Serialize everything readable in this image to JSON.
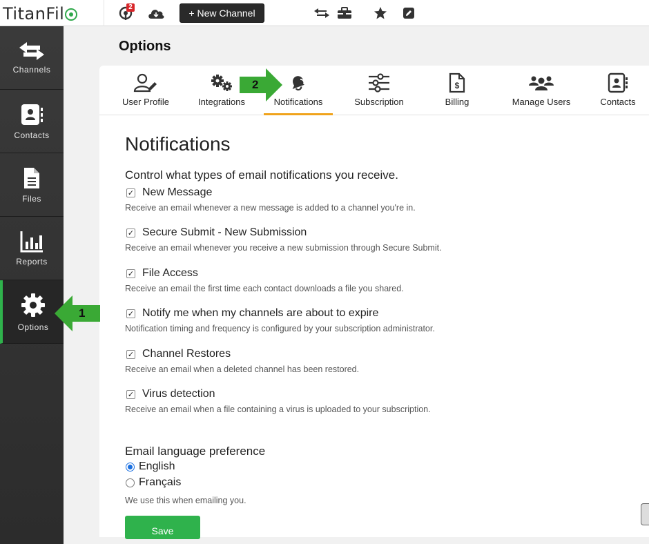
{
  "app": {
    "logo_text": "TitanFil",
    "logo_mark_icon": "titanfile-e-logo",
    "notification_count": "2",
    "new_channel_label": "+ New Channel"
  },
  "sidebar": {
    "items": [
      {
        "label": "Channels",
        "icon": "arrows-left-right-icon"
      },
      {
        "label": "Contacts",
        "icon": "contact-card-icon"
      },
      {
        "label": "Files",
        "icon": "file-icon"
      },
      {
        "label": "Reports",
        "icon": "bar-chart-icon"
      },
      {
        "label": "Options",
        "icon": "gear-icon",
        "active": true
      }
    ]
  },
  "page": {
    "title": "Options"
  },
  "tabs": [
    {
      "label": "User Profile",
      "icon": "user-edit-icon"
    },
    {
      "label": "Integrations",
      "icon": "gears-icon"
    },
    {
      "label": "Notifications",
      "icon": "bell-icon",
      "active": true
    },
    {
      "label": "Subscription",
      "icon": "sliders-icon"
    },
    {
      "label": "Billing",
      "icon": "invoice-icon"
    },
    {
      "label": "Manage Users",
      "icon": "users-icon"
    },
    {
      "label": "Contacts",
      "icon": "contact-card-icon"
    }
  ],
  "notifications": {
    "title": "Notifications",
    "intro": "Control what types of email notifications you receive.",
    "options": [
      {
        "label": "New Message",
        "desc": "Receive an email whenever a new message is added to a channel you're in.",
        "checked": true
      },
      {
        "label": "Secure Submit - New Submission",
        "desc": "Receive an email whenever you receive a new submission through Secure Submit.",
        "checked": true
      },
      {
        "label": "File Access",
        "desc": "Receive an email the first time each contact downloads a file you shared.",
        "checked": true
      },
      {
        "label": "Notify me when my channels are about to expire",
        "desc": "Notification timing and frequency is configured by your subscription administrator.",
        "checked": true
      },
      {
        "label": "Channel Restores",
        "desc": "Receive an email when a deleted channel has been restored.",
        "checked": true
      },
      {
        "label": "Virus detection",
        "desc": "Receive an email when a file containing a virus is uploaded to your subscription.",
        "checked": true
      }
    ],
    "language": {
      "title": "Email language preference",
      "options": [
        {
          "label": "English",
          "selected": true
        },
        {
          "label": "Français",
          "selected": false
        }
      ],
      "note": "We use this when emailing you."
    },
    "save_label": "Save"
  },
  "annotations": [
    {
      "number": "1",
      "color": "#3aa935"
    },
    {
      "number": "2",
      "color": "#3aa935"
    }
  ],
  "colors": {
    "accent_green": "#2fb24c",
    "tab_underline": "#f0a31b",
    "sidebar_bg": "#333333"
  }
}
